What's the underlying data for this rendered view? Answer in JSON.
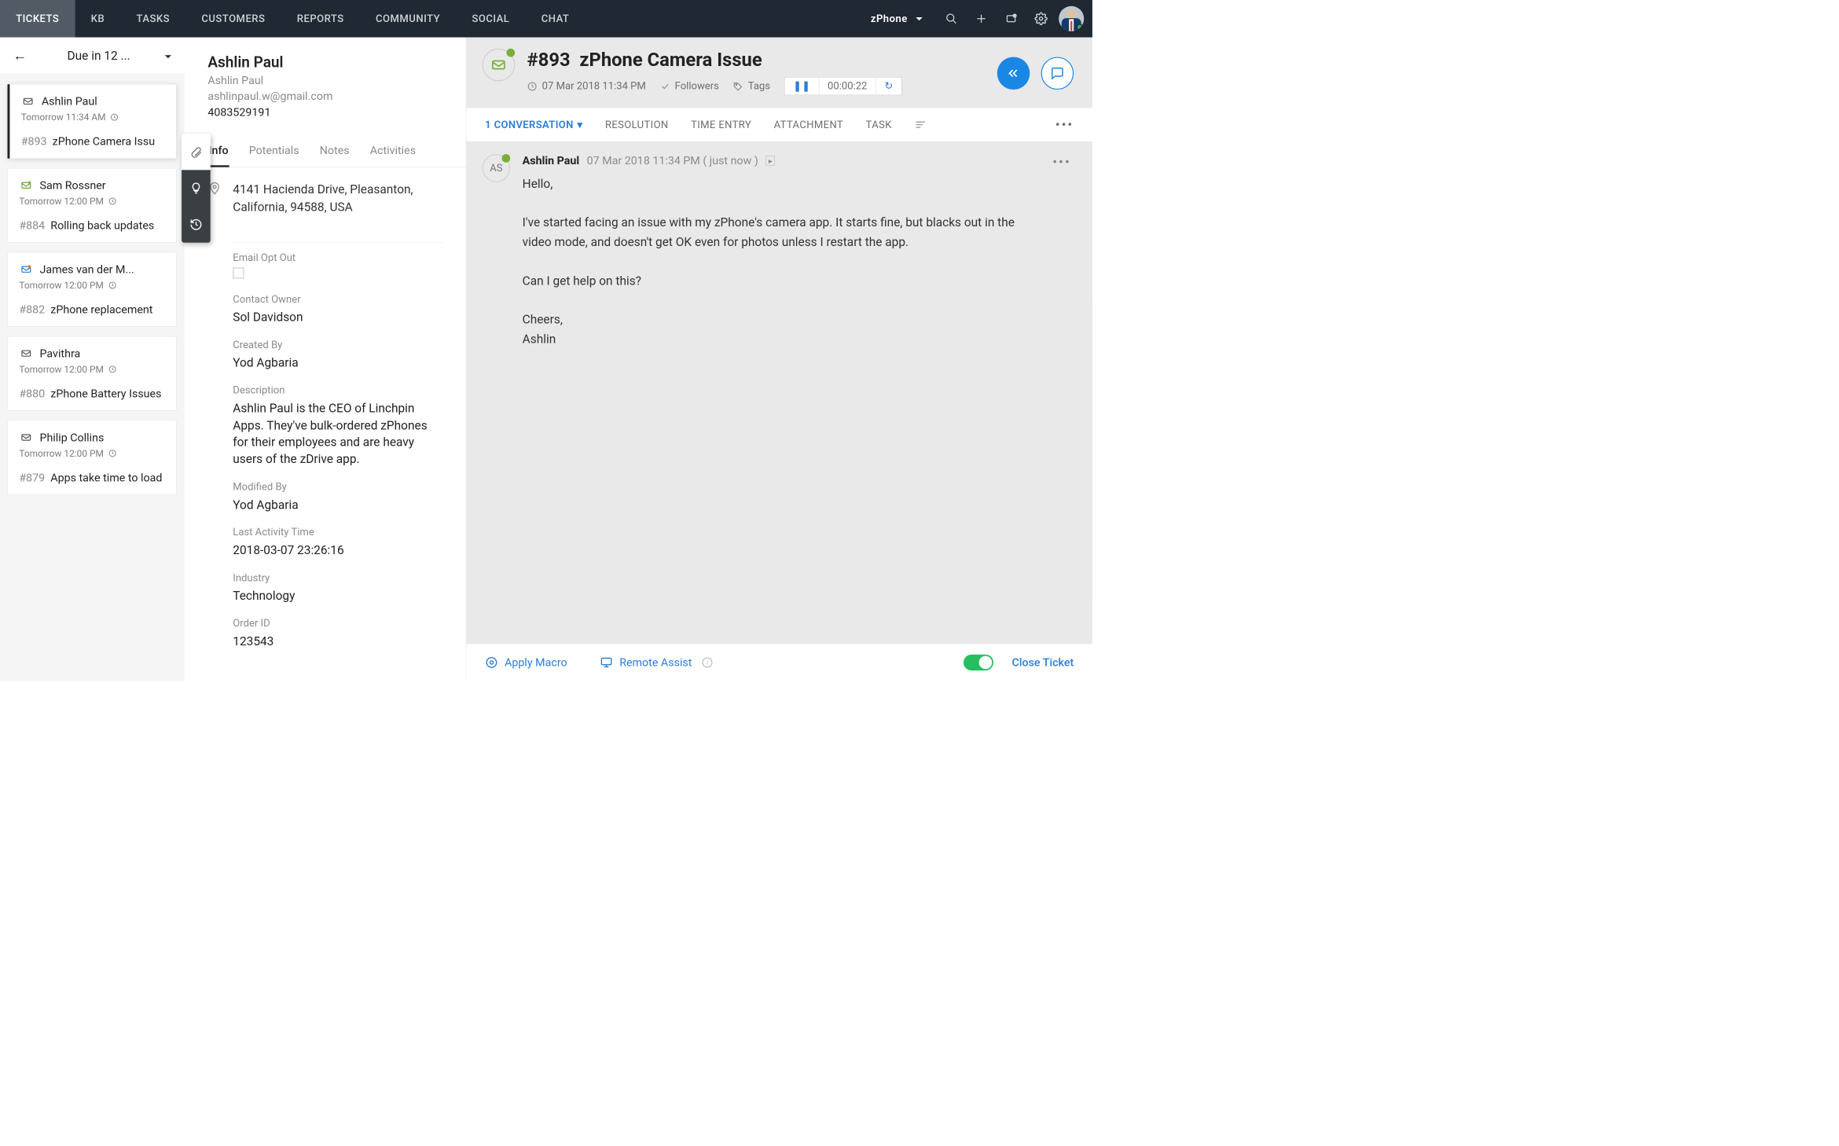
{
  "topnav": {
    "items": [
      "TICKETS",
      "KB",
      "TASKS",
      "CUSTOMERS",
      "REPORTS",
      "COMMUNITY",
      "SOCIAL",
      "CHAT"
    ],
    "brand": "zPhone"
  },
  "filter": {
    "label": "Due in 12 ..."
  },
  "tickets": [
    {
      "name": "Ashlin Paul",
      "when": "Tomorrow 11:34 AM",
      "num": "#893",
      "title": "zPhone Camera Issu",
      "selected": true,
      "channel": "email",
      "due_flag": "normal"
    },
    {
      "name": "Sam Rossner",
      "when": "Tomorrow 12:00 PM",
      "num": "#884",
      "title": "Rolling back updates",
      "selected": false,
      "channel": "reply",
      "due_flag": "normal"
    },
    {
      "name": "James van der M...",
      "when": "Tomorrow 12:00 PM",
      "num": "#882",
      "title": "zPhone replacement",
      "selected": false,
      "channel": "blue",
      "due_flag": "orange"
    },
    {
      "name": "Pavithra",
      "when": "Tomorrow 12:00 PM",
      "num": "#880",
      "title": "zPhone Battery Issues",
      "selected": false,
      "channel": "email",
      "due_flag": "normal"
    },
    {
      "name": "Philip Collins",
      "when": "Tomorrow 12:00 PM",
      "num": "#879",
      "title": "Apps take time to load",
      "selected": false,
      "channel": "email",
      "due_flag": "normal"
    }
  ],
  "contact": {
    "name": "Ashlin Paul",
    "company": "Ashlin Paul",
    "email": "ashlinpaul.w@gmail.com",
    "phone": "4083529191",
    "tabs": [
      "Info",
      "Potentials",
      "Notes",
      "Activities"
    ],
    "address": "4141 Hacienda Drive, Pleasanton, California, 94588, USA",
    "fields": {
      "email_opt_out_label": "Email Opt Out",
      "contact_owner_label": "Contact Owner",
      "contact_owner": "Sol Davidson",
      "created_by_label": "Created By",
      "created_by": "Yod Agbaria",
      "description_label": "Description",
      "description": "Ashlin Paul is the CEO of Linchpin Apps. They've bulk-ordered zPhones for their employees and are heavy users of the zDrive app.",
      "modified_by_label": "Modified By",
      "modified_by": "Yod Agbaria",
      "last_activity_label": "Last Activity Time",
      "last_activity": "2018-03-07 23:26:16",
      "industry_label": "Industry",
      "industry": "Technology",
      "order_id_label": "Order ID",
      "order_id": "123543"
    }
  },
  "ticket_detail": {
    "id": "#893",
    "title": "zPhone Camera Issue",
    "created": "07 Mar 2018 11:34 PM",
    "followers_label": "Followers",
    "tags_label": "Tags",
    "timer": "00:00:22",
    "tabs": {
      "conversation": "1 CONVERSATION",
      "resolution": "RESOLUTION",
      "time_entry": "TIME ENTRY",
      "attachment": "ATTACHMENT",
      "task": "TASK"
    },
    "message": {
      "avatar_initials": "AS",
      "author": "Ashlin Paul",
      "ts": "07 Mar 2018 11:34 PM ( just now )",
      "body": "Hello,\n\nI've started facing an issue with my zPhone's camera app. It starts fine, but blacks out in the video mode, and doesn't get OK even for photos unless I restart the app.\n\nCan I get help on this?\n\nCheers,\nAshlin"
    }
  },
  "footer": {
    "apply_macro": "Apply Macro",
    "remote_assist": "Remote Assist",
    "close_ticket": "Close Ticket"
  }
}
